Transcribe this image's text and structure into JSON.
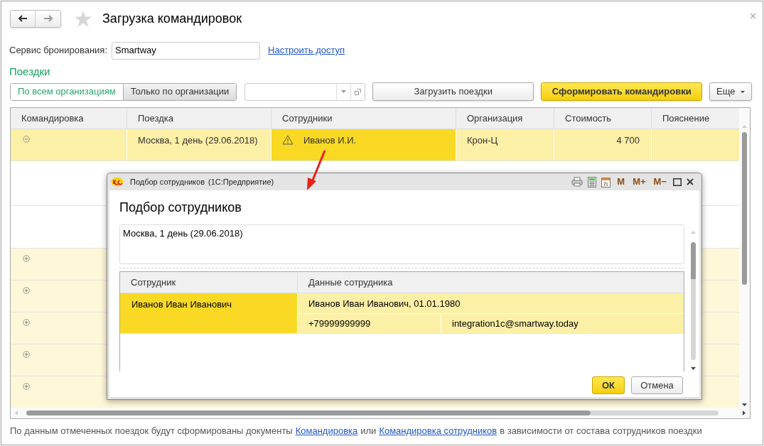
{
  "window": {
    "title": "Загрузка командировок"
  },
  "booking_service": {
    "label": "Сервис бронирования:",
    "value": "Smartway",
    "link": "Настроить доступ"
  },
  "section_title": "Поездки",
  "filter_tabs": [
    {
      "label": "По всем организациям",
      "selected": true
    },
    {
      "label": "Только по организации",
      "selected": false
    }
  ],
  "buttons": {
    "load": "Загрузить поездки",
    "create": "Сформировать командировки",
    "more": "Еще"
  },
  "table": {
    "columns": [
      "Командировка",
      "Поездка",
      "Сотрудники",
      "Организация",
      "Стоимость",
      "Пояснение"
    ],
    "rows": [
      {
        "kind": "trip",
        "selected": true,
        "expanded": true,
        "trip": "Москва, 1 день (29.06.2018)",
        "employees": "Иванов И.И.",
        "warning": true,
        "organization": "Крон-Ц",
        "cost": "4 700"
      },
      {
        "kind": "blank"
      },
      {
        "kind": "blank"
      },
      {
        "kind": "trip",
        "expanded": false
      },
      {
        "kind": "trip",
        "expanded": false
      },
      {
        "kind": "trip",
        "expanded": false
      },
      {
        "kind": "trip",
        "expanded": false
      },
      {
        "kind": "trip",
        "expanded": false
      }
    ]
  },
  "footer": {
    "before": "По данным отмеченных поездок будут сформированы документы",
    "link1": "Командировка",
    "middle": "или",
    "link2": "Командировка сотрудников",
    "after": "в зависимости от состава сотрудников поездки"
  },
  "dialog": {
    "title": "Подбор сотрудников",
    "app": "(1С:Предприятие)",
    "heading": "Подбор сотрудников",
    "memory_buttons": [
      "M",
      "M+",
      "M−"
    ],
    "trip": "Москва, 1 день (29.06.2018)",
    "columns": [
      "Сотрудник",
      "Данные сотрудника"
    ],
    "rows": [
      {
        "name": "Иванов Иван Иванович",
        "full": "Иванов Иван Иванович, 01.01.1980",
        "phone": "+79999999999",
        "email": "integration1c@smartway.today"
      }
    ],
    "ok": "ОК",
    "cancel": "Отмена"
  }
}
